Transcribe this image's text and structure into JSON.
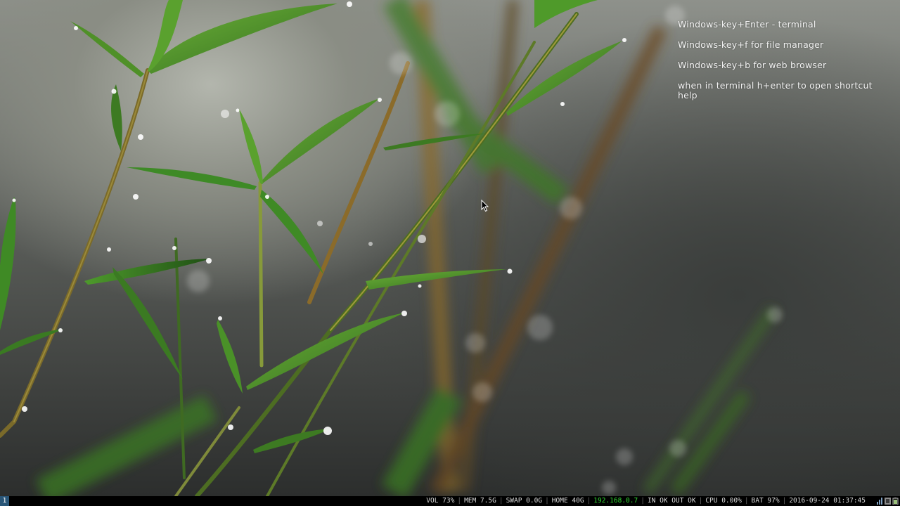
{
  "desktop": {
    "hints": [
      "Windows-key+Enter - terminal",
      "Windows-key+f for file manager",
      "Windows-key+b for web browser",
      "when in terminal h+enter to open shortcut help"
    ]
  },
  "statusbar": {
    "workspace": "1",
    "volume": "VOL 73%",
    "memory": "MEM 7.5G",
    "swap": "SWAP 0.0G",
    "home": "HOME 40G",
    "ip": "192.168.0.7",
    "network": "IN OK OUT OK",
    "cpu": "CPU 0.00%",
    "battery": "BAT 97%",
    "datetime": "2016-09-24 01:37:45",
    "colors": {
      "background": "#000000",
      "workspace": "#285577",
      "ip": "#33dd33",
      "text": "#d9d9d9"
    },
    "tray_icons": [
      "network-icon",
      "volume-tray-icon",
      "battery-tray-icon"
    ]
  }
}
